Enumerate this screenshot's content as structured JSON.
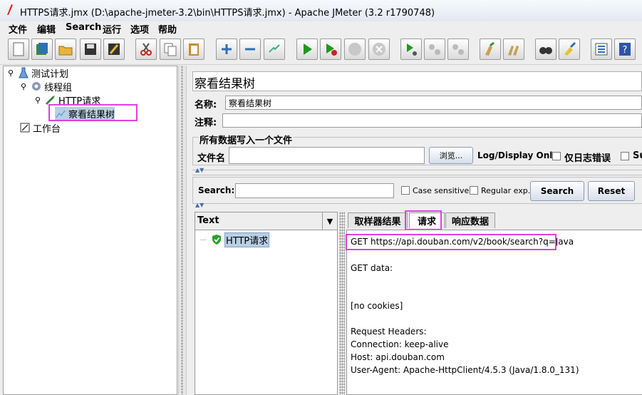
{
  "window": {
    "title": "HTTPS请求.jmx (D:\\apache-jmeter-3.2\\bin\\HTTPS请求.jmx) - Apache JMeter (3.2 r1790748)"
  },
  "menu": [
    "文件",
    "编辑",
    "Search",
    "运行",
    "选项",
    "帮助"
  ],
  "toolbar_icons": [
    "new-icon",
    "templates-icon",
    "open-icon",
    "save-icon",
    "save-as-icon",
    "cut-icon",
    "copy-icon",
    "paste-icon",
    "expand-icon",
    "collapse-icon",
    "toggle-icon",
    "start-icon",
    "start-no-pause-icon",
    "stop-icon",
    "shutdown-icon",
    "remote-start-icon",
    "remote-stop-icon",
    "remote-exit-icon",
    "clear-icon",
    "clear-all-icon",
    "search-icon",
    "reset-search-icon",
    "function-helper-icon",
    "help-icon"
  ],
  "tree": {
    "test_plan": "测试计划",
    "thread_group": "线程组",
    "http_request": "HTTP请求",
    "listener": "察看结果树",
    "workbench": "工作台"
  },
  "panel": {
    "title": "察看结果树",
    "name_label": "名称:",
    "name_value": "察看结果树",
    "comment_label": "注释:",
    "file_section": "所有数据写入一个文件",
    "filename_label": "文件名",
    "browse_label": "浏览...",
    "log_display_label": "Log/Display Only:",
    "errors_only_label": "仅日志错误",
    "successes_label": "Su"
  },
  "search": {
    "label": "Search:",
    "case_sensitive": "Case sensitive",
    "regex": "Regular exp.",
    "search_button": "Search",
    "reset_button": "Reset"
  },
  "results": {
    "renderer": "Text",
    "sample": "HTTP请求",
    "tabs": [
      "取样器结果",
      "请求",
      "响应数据"
    ],
    "active_tab": "请求",
    "lines": [
      "GET https://api.douban.com/v2/book/search?q=Java",
      "GET data:",
      "[no cookies]",
      "Request Headers:",
      "Connection: keep-alive",
      "Host: api.douban.com",
      "User-Agent: Apache-HttpClient/4.5.3 (Java/1.8.0_131)"
    ]
  },
  "colors": {
    "highlight": "#e040e0",
    "selection": "#b8cfe5"
  }
}
